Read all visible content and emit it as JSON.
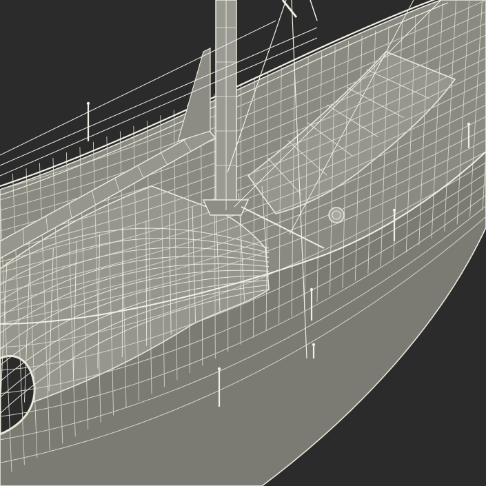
{
  "scene": {
    "subject": "sailboat-wireframe-render",
    "colors": {
      "background": "#2b2b2b",
      "hull_fill": "#7b7b73",
      "deck_fill": "#8a8a82",
      "cabin_fill": "#96968e",
      "wire": "#e9e9dc",
      "wire_dim": "#d4d4c6",
      "rigging": "#f0f0e6",
      "shadow": "#5e5e57"
    }
  }
}
